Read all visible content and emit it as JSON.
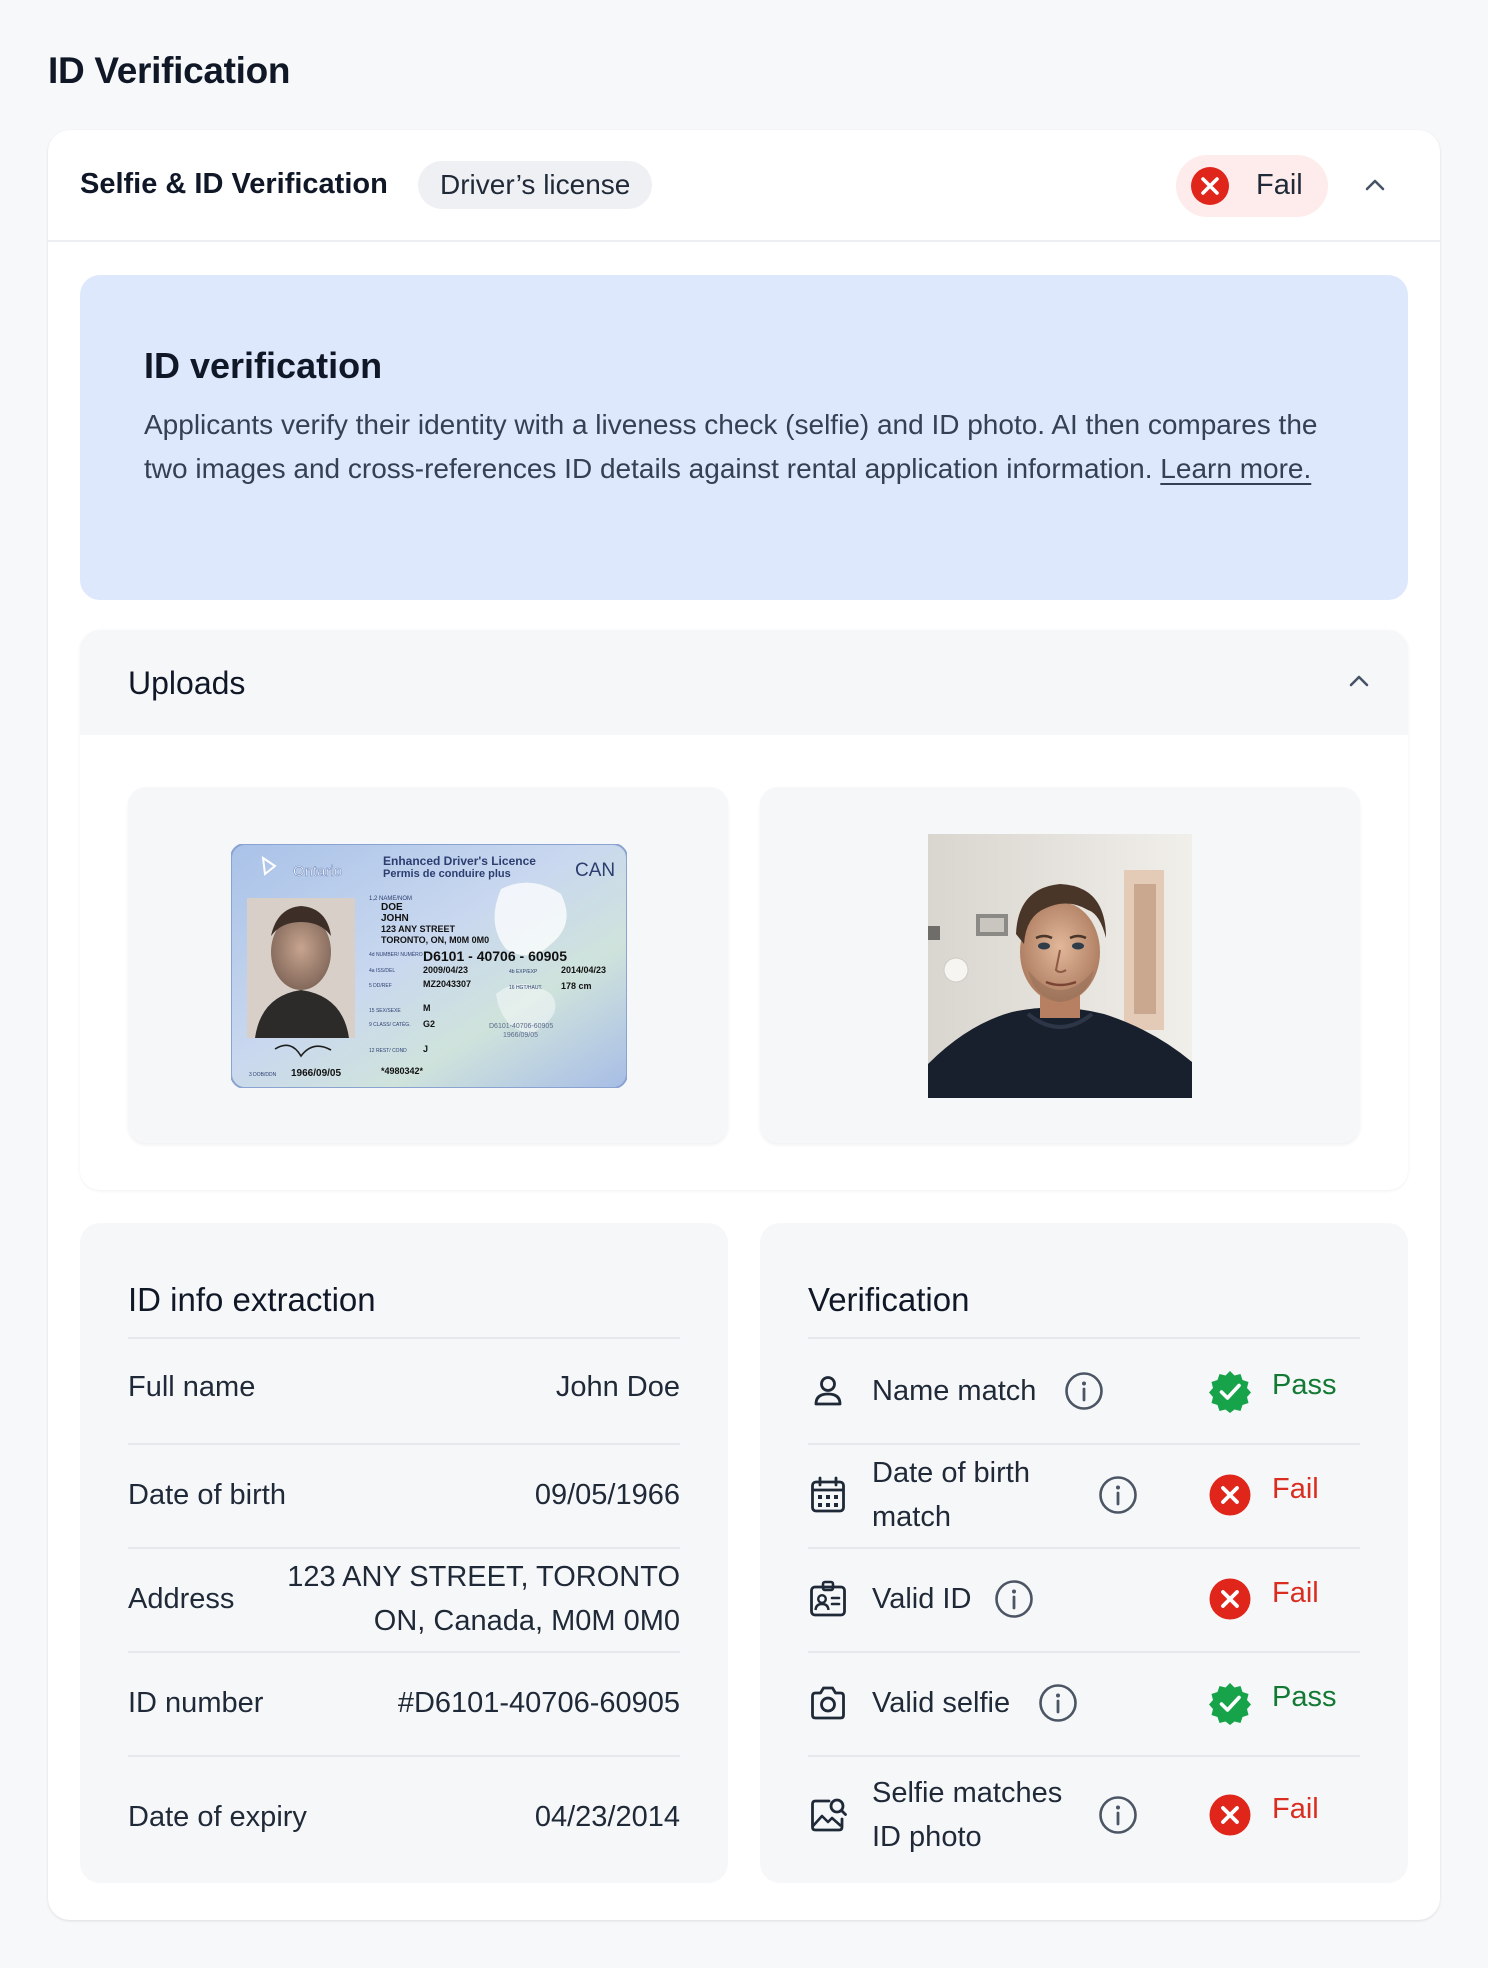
{
  "page": {
    "title": "ID Verification"
  },
  "card": {
    "title": "Selfie & ID Verification",
    "document_type": "Driver’s license",
    "status": "Fail"
  },
  "info_box": {
    "title": "ID verification",
    "text": "Applicants verify their identity with a liveness check (selfie) and ID photo. AI then compares the two images and cross-references ID details against rental application information.",
    "link": "Learn more."
  },
  "uploads": {
    "title": "Uploads",
    "id_card": {
      "province": "Ontario",
      "licence_title": "Enhanced Driver's Licence",
      "licence_subtitle": "Permis de conduire plus",
      "country": "CAN",
      "name_label": "1,2 NAME/NOM",
      "last_name": "DOE",
      "first_name": "JOHN",
      "street": "123 ANY STREET",
      "city": "TORONTO, ON, M0M 0M0",
      "number_label": "4d NUMBER/ NUMÉRO",
      "number": "D6101 - 40706 - 60905",
      "issued_label": "4a ISS/DEL",
      "issued": "2009/04/23",
      "exp_label": "4b EXP/EXP",
      "expiry": "2014/04/23",
      "dd_label": "5 DD/REF",
      "dd": "MZ2043307",
      "height_label": "16 HGT/HAUT.",
      "height": "178 cm",
      "sex_label": "15 SEX/SEXE",
      "sex": "M",
      "class_label": "9 CLASS/ CATÉG.",
      "class": "G2",
      "rest_label": "12 REST/ COND",
      "rest": "J",
      "ghost_number": "D6101-40706-60905",
      "ghost_dob": "1966/09/05",
      "dob_label": "3 DOB/DDN",
      "dob": "1966/09/05",
      "bottom_number": "*4980342*"
    }
  },
  "extraction": {
    "title": "ID info extraction",
    "rows": [
      {
        "label": "Full name",
        "value": "John Doe"
      },
      {
        "label": "Date of birth",
        "value": "09/05/1966"
      },
      {
        "label": "Address",
        "value_line1": "123 ANY STREET, TORONTO",
        "value_line2": "ON, Canada, M0M 0M0"
      },
      {
        "label": "ID number",
        "value": "#D6101-40706-60905"
      },
      {
        "label": "Date of expiry",
        "value": "04/23/2014"
      }
    ]
  },
  "verification": {
    "title": "Verification",
    "rows": [
      {
        "label": "Name match",
        "icon": "user-icon",
        "result": "Pass"
      },
      {
        "label_line1": "Date of birth",
        "label_line2": "match",
        "icon": "calendar-icon",
        "result": "Fail"
      },
      {
        "label": "Valid ID",
        "icon": "id-badge-icon",
        "result": "Fail"
      },
      {
        "label": "Valid selfie",
        "icon": "camera-icon",
        "result": "Pass"
      },
      {
        "label_line1": "Selfie matches",
        "label_line2": "ID photo",
        "icon": "image-search-icon",
        "result": "Fail"
      }
    ]
  },
  "colors": {
    "pass": "#127a34",
    "fail": "#d92d20",
    "info_bg": "#dde8fc",
    "fail_pill_bg": "#fdeceb"
  }
}
